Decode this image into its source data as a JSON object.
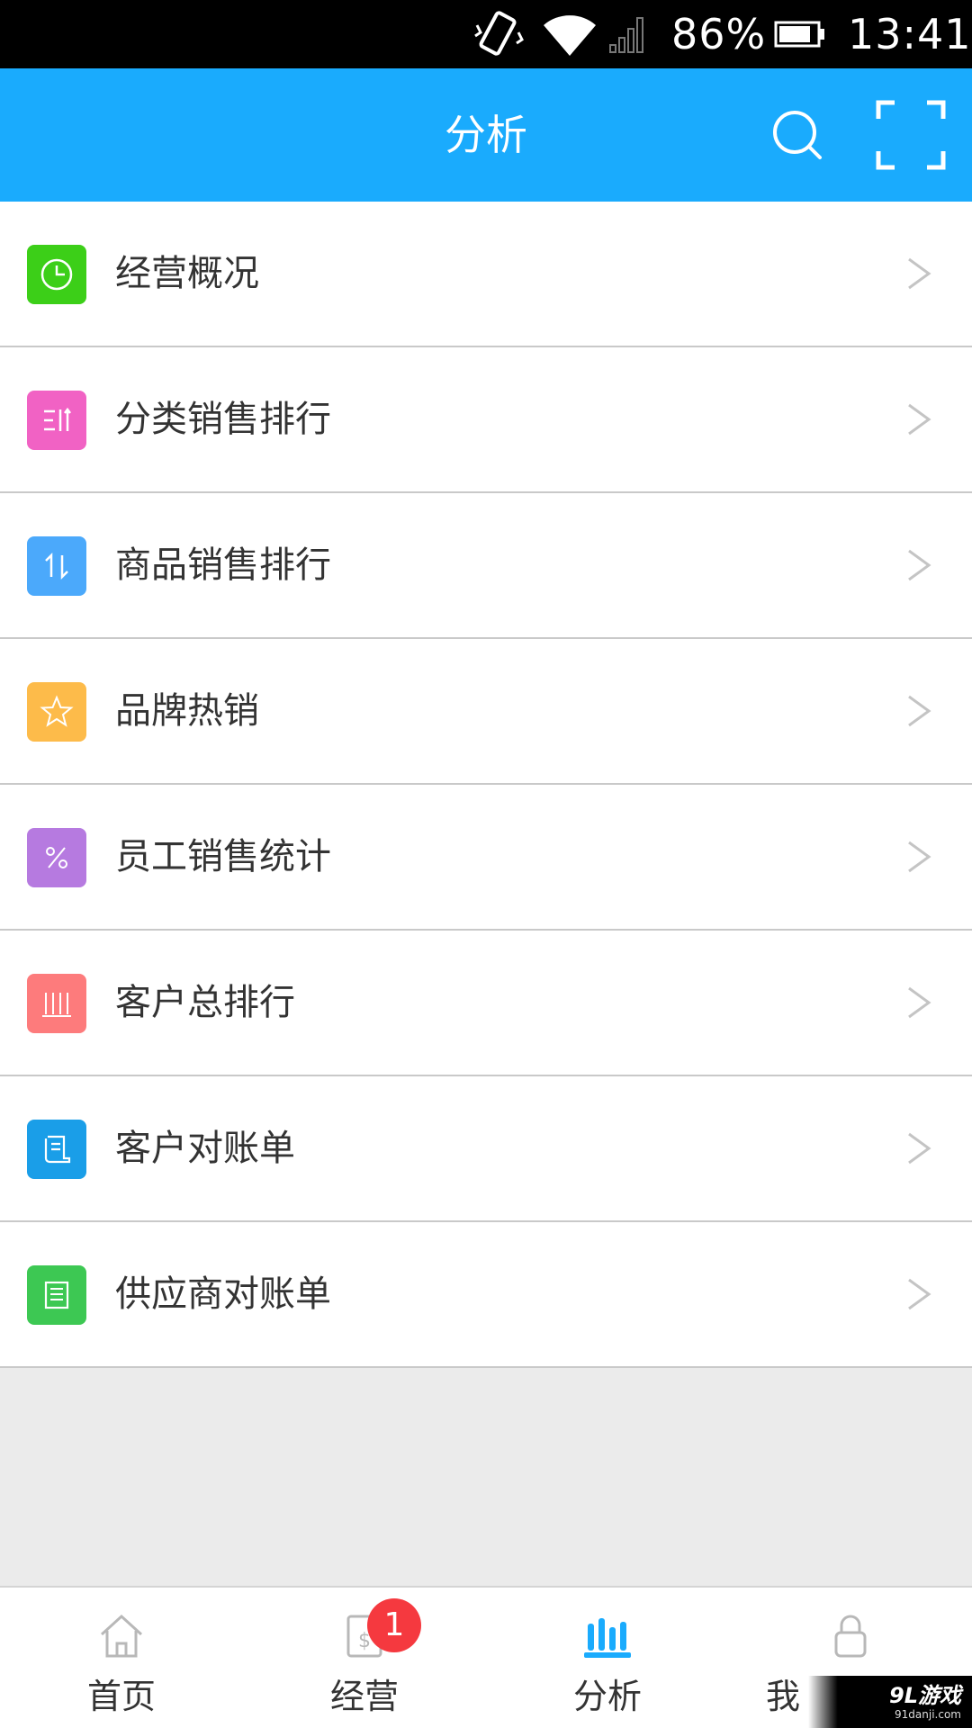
{
  "status_bar": {
    "battery_percent": "86%",
    "time": "13:41",
    "icons": [
      "vibrate-icon",
      "wifi-icon",
      "signal-icon",
      "battery-icon"
    ]
  },
  "header": {
    "title": "分析",
    "icons": [
      "search-icon",
      "scan-icon"
    ],
    "color": "#1aabfd"
  },
  "list": {
    "items": [
      {
        "label": "经营概况",
        "icon": "clock-icon",
        "color": "#3ccf18"
      },
      {
        "label": "分类销售排行",
        "icon": "sort-icon",
        "color": "#f162c4"
      },
      {
        "label": "商品销售排行",
        "icon": "up-down-arrows-icon",
        "color": "#4ba9fb"
      },
      {
        "label": "品牌热销",
        "icon": "star-icon",
        "color": "#fdbb4a"
      },
      {
        "label": "员工销售统计",
        "icon": "percent-icon",
        "color": "#b67ae0"
      },
      {
        "label": "客户总排行",
        "icon": "bars-icon",
        "color": "#fd7b7c"
      },
      {
        "label": "客户对账单",
        "icon": "receipt-icon",
        "color": "#1a9ee8"
      },
      {
        "label": "供应商对账单",
        "icon": "document-icon",
        "color": "#3dc853"
      }
    ]
  },
  "bottom_nav": {
    "tabs": [
      {
        "label": "首页",
        "icon": "home-icon"
      },
      {
        "label": "经营",
        "icon": "bill-icon",
        "badge": "1"
      },
      {
        "label": "分析",
        "icon": "chart-icon",
        "active": true
      },
      {
        "label": "我",
        "icon": "lock-icon"
      }
    ],
    "active_color": "#1aabfd"
  },
  "watermark": {
    "main": "9L游戏",
    "sub": "91danji.com"
  }
}
